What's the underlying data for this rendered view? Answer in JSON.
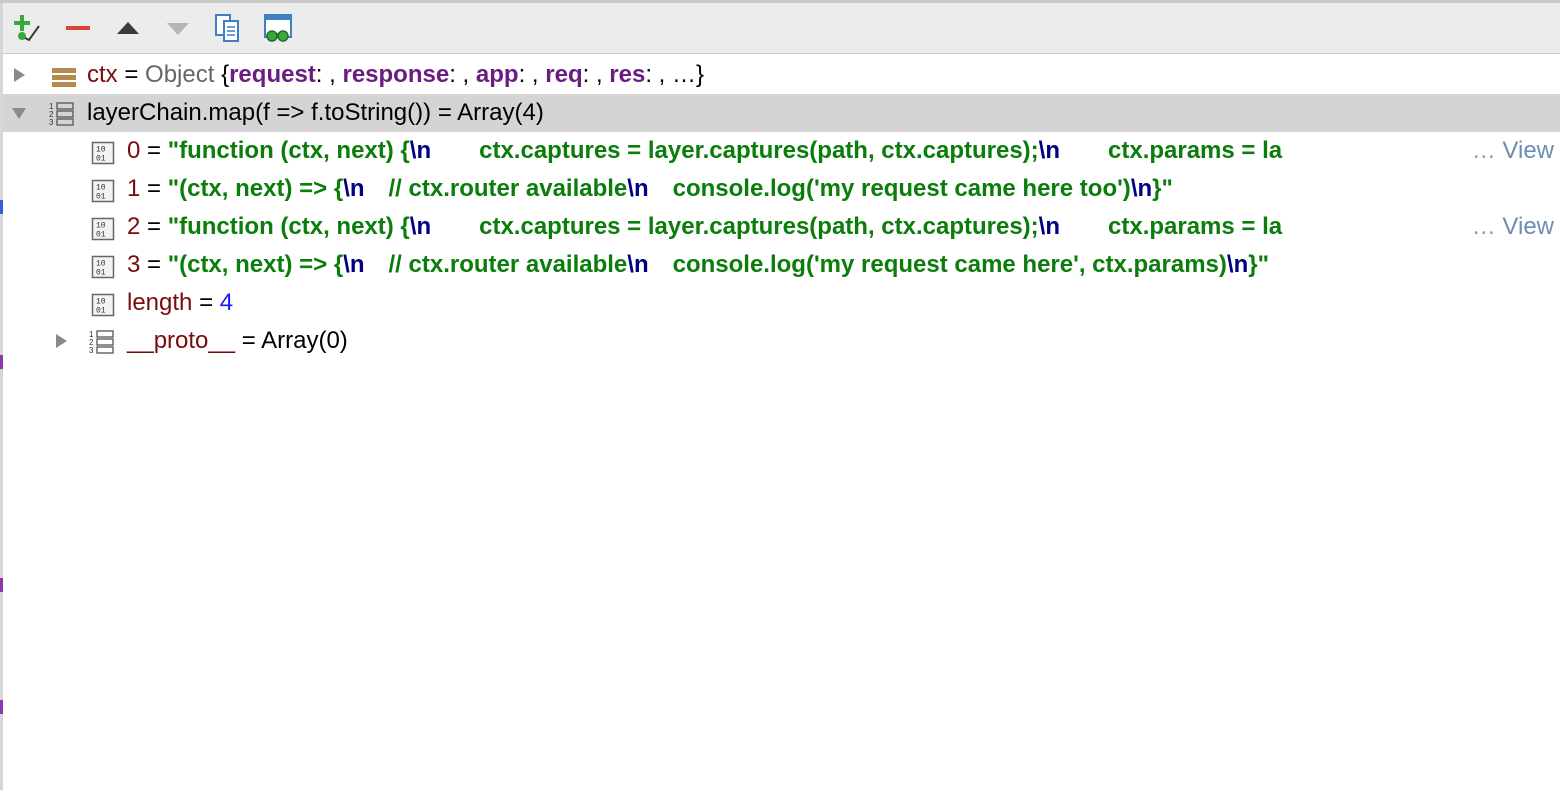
{
  "toolbar": {
    "buttons": [
      "add-watch",
      "remove-watch",
      "move-up",
      "move-down",
      "duplicate-watch",
      "show-watches-in-variables"
    ]
  },
  "colors": {
    "string": "#0a7d0a",
    "escape": "#000080",
    "name": "#7a0a0a",
    "key": "#6b1c82",
    "number": "#1a1aff",
    "link": "#6b8db0",
    "selected_row": "#d4d4d4"
  },
  "watches": {
    "ctx": {
      "name": "ctx",
      "eq": "=",
      "type": "Object",
      "open": "{",
      "k1": "request",
      "c1": ": ,",
      "k2": "response",
      "c2": ": ,",
      "k3": "app",
      "c3": ": ,",
      "k4": "req",
      "c4": ": ,",
      "k5": "res",
      "c5": ": , …}"
    },
    "chain": {
      "expr": "layerChain.map(f => f.toString())",
      "eq": "=",
      "value": "Array(4)",
      "items": [
        {
          "index": "0",
          "eq": "=",
          "s1": "\"function (ctx, next) {",
          "e1": "\\n",
          "s2": "ctx.captures = layer.captures(path, ctx.captures);",
          "e2": "\\n",
          "s3": "ctx.params = la",
          "ellipsis": "…",
          "view": "View"
        },
        {
          "index": "1",
          "eq": "=",
          "s1": "\"(ctx, next) => {",
          "e1": "\\n",
          "s2": "// ctx.router available",
          "e2": "\\n",
          "s3": "console.log('my request came here too')",
          "e3": "\\n",
          "s4": "}\""
        },
        {
          "index": "2",
          "eq": "=",
          "s1": "\"function (ctx, next) {",
          "e1": "\\n",
          "s2": "ctx.captures = layer.captures(path, ctx.captures);",
          "e2": "\\n",
          "s3": "ctx.params = la",
          "ellipsis": "…",
          "view": "View"
        },
        {
          "index": "3",
          "eq": "=",
          "s1": "\"(ctx, next) => {",
          "e1": "\\n",
          "s2": "// ctx.router available",
          "e2": "\\n",
          "s3": "console.log('my request came here', ctx.params)",
          "e3": "\\n",
          "s4": "}\""
        }
      ],
      "length": {
        "name": "length",
        "eq": "=",
        "value": "4"
      },
      "proto": {
        "name": "__proto__",
        "eq": "=",
        "value": "Array(0)"
      }
    }
  }
}
